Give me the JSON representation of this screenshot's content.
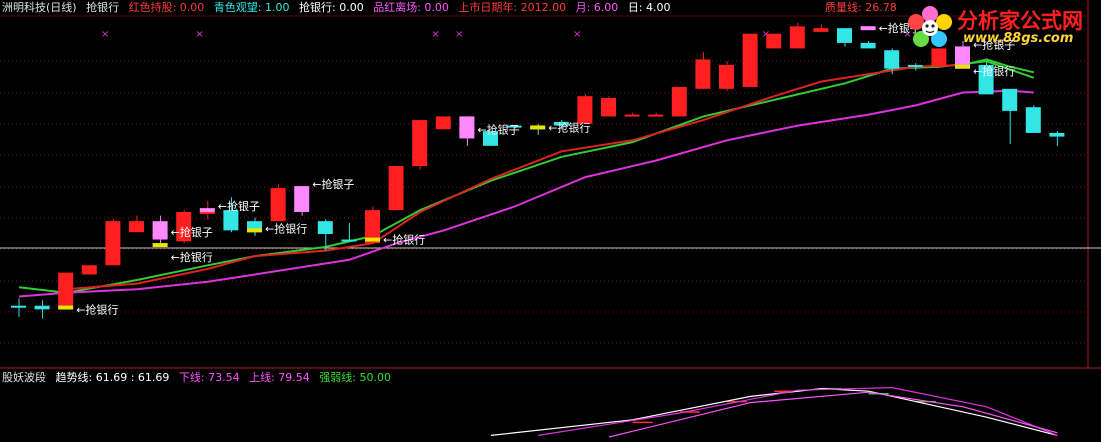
{
  "header": {
    "stock": {
      "text": "洲明科技(日线)",
      "color": "#e0e0e0"
    },
    "indicator": {
      "text": "抢银行",
      "color": "#e0e0e0"
    },
    "items": [
      {
        "label": "红色持股: 0.00",
        "color": "#ff3b3b"
      },
      {
        "label": "青色观望: 1.00",
        "color": "#33e6e6"
      },
      {
        "label": "抢银行: 0.00",
        "color": "#ffffff"
      },
      {
        "label": "品红离场: 0.00",
        "color": "#ff55ff"
      },
      {
        "label": "上市日期年: 2012.00",
        "color": "#ff3b3b"
      },
      {
        "label": "月: 6.00",
        "color": "#ff55ff"
      },
      {
        "label": "日: 4.00",
        "color": "#ffffff"
      }
    ],
    "support_label": "质量线: 26.78",
    "support_color": "#ff3b3b"
  },
  "logo": {
    "brand": "分析家公式网",
    "url": "www.88gs.com"
  },
  "sub_header": {
    "name": {
      "text": "股妖波段",
      "color": "#e0e0e0"
    },
    "items": [
      {
        "label": "趋势线: 61.69 : 61.69",
        "color": "#ffffff"
      },
      {
        "label": "下线: 73.54",
        "color": "#ff55ff"
      },
      {
        "label": "上线: 79.54",
        "color": "#ff55ff"
      },
      {
        "label": "强弱线: 50.00",
        "color": "#33dd33"
      }
    ]
  },
  "colors": {
    "up": "#ff1f1f",
    "down": "#33e6e6",
    "pink": "#ff88ff",
    "yellow": "#e6e600",
    "ma_red": "#dd2222",
    "ma_magenta": "#dd33dd",
    "ma_green": "#33cc33",
    "grid": "#7a1010",
    "label": "#ffffff"
  },
  "chart_data": {
    "type": "candlestick",
    "y_range": [
      12.0,
      30.5
    ],
    "candles": [
      {
        "o": 14.9,
        "c": 14.9,
        "h": 15.3,
        "l": 14.3,
        "color": "down"
      },
      {
        "o": 14.9,
        "c": 14.7,
        "h": 15.2,
        "l": 14.2,
        "color": "down"
      },
      {
        "o": 14.9,
        "c": 16.7,
        "h": 16.7,
        "l": 14.9,
        "color": "up"
      },
      {
        "o": 16.6,
        "c": 17.1,
        "h": 17.1,
        "l": 16.6,
        "color": "up"
      },
      {
        "o": 17.1,
        "c": 19.5,
        "h": 19.6,
        "l": 17.1,
        "color": "up"
      },
      {
        "o": 18.9,
        "c": 19.5,
        "h": 19.8,
        "l": 18.9,
        "color": "up"
      },
      {
        "o": 19.5,
        "c": 18.5,
        "h": 19.8,
        "l": 18.3,
        "color": "pink"
      },
      {
        "o": 18.4,
        "c": 20.0,
        "h": 20.1,
        "l": 18.3,
        "color": "up"
      },
      {
        "o": 20.0,
        "c": 20.0,
        "h": 20.6,
        "l": 19.6,
        "color": "up"
      },
      {
        "o": 20.1,
        "c": 19.0,
        "h": 20.8,
        "l": 18.9,
        "color": "down"
      },
      {
        "o": 19.5,
        "c": 18.9,
        "h": 19.7,
        "l": 18.7,
        "color": "down"
      },
      {
        "o": 19.5,
        "c": 21.3,
        "h": 21.5,
        "l": 19.5,
        "color": "up"
      },
      {
        "o": 21.2,
        "c": 20.0,
        "h": 21.3,
        "l": 19.8,
        "color": "pink"
      },
      {
        "o": 19.5,
        "c": 18.8,
        "h": 19.6,
        "l": 17.9,
        "color": "down"
      },
      {
        "o": 18.5,
        "c": 18.5,
        "h": 19.4,
        "l": 18.4,
        "color": "down"
      },
      {
        "o": 18.3,
        "c": 20.1,
        "h": 20.3,
        "l": 18.3,
        "color": "up"
      },
      {
        "o": 20.1,
        "c": 22.5,
        "h": 22.5,
        "l": 20.1,
        "color": "up"
      },
      {
        "o": 22.5,
        "c": 25.0,
        "h": 25.0,
        "l": 22.3,
        "color": "up"
      },
      {
        "o": 24.5,
        "c": 25.2,
        "h": 25.2,
        "l": 24.5,
        "color": "up"
      },
      {
        "o": 25.2,
        "c": 24.0,
        "h": 25.2,
        "l": 23.6,
        "color": "pink"
      },
      {
        "o": 24.4,
        "c": 23.6,
        "h": 24.4,
        "l": 23.6,
        "color": "down"
      },
      {
        "o": 24.7,
        "c": 24.7,
        "h": 24.7,
        "l": 24.6,
        "color": "down"
      },
      {
        "o": 24.6,
        "c": 24.6,
        "h": 24.8,
        "l": 24.2,
        "color": "down"
      },
      {
        "o": 24.9,
        "c": 24.7,
        "h": 25.0,
        "l": 24.5,
        "color": "down"
      },
      {
        "o": 24.8,
        "c": 26.3,
        "h": 26.4,
        "l": 24.8,
        "color": "up"
      },
      {
        "o": 25.2,
        "c": 26.2,
        "h": 26.3,
        "l": 25.2,
        "color": "up"
      },
      {
        "o": 25.2,
        "c": 25.3,
        "h": 25.4,
        "l": 25.2,
        "color": "up"
      },
      {
        "o": 25.2,
        "c": 25.3,
        "h": 25.4,
        "l": 25.2,
        "color": "up"
      },
      {
        "o": 25.2,
        "c": 26.8,
        "h": 26.8,
        "l": 25.2,
        "color": "up"
      },
      {
        "o": 26.7,
        "c": 28.3,
        "h": 28.7,
        "l": 26.7,
        "color": "up"
      },
      {
        "o": 26.7,
        "c": 28.0,
        "h": 28.2,
        "l": 26.6,
        "color": "up"
      },
      {
        "o": 26.8,
        "c": 29.7,
        "h": 29.7,
        "l": 26.8,
        "color": "up"
      },
      {
        "o": 28.9,
        "c": 29.7,
        "h": 29.7,
        "l": 28.9,
        "color": "up"
      },
      {
        "o": 28.9,
        "c": 30.1,
        "h": 30.3,
        "l": 28.9,
        "color": "up"
      },
      {
        "o": 30.0,
        "c": 29.8,
        "h": 30.2,
        "l": 29.8,
        "color": "up"
      },
      {
        "o": 30.0,
        "c": 29.2,
        "h": 30.0,
        "l": 29.0,
        "color": "down"
      },
      {
        "o": 29.2,
        "c": 28.9,
        "h": 29.3,
        "l": 28.9,
        "color": "down"
      },
      {
        "o": 28.8,
        "c": 27.8,
        "h": 28.9,
        "l": 27.5,
        "color": "down"
      },
      {
        "o": 28.0,
        "c": 27.9,
        "h": 28.1,
        "l": 27.7,
        "color": "down"
      },
      {
        "o": 27.9,
        "c": 28.9,
        "h": 28.9,
        "l": 27.9,
        "color": "up"
      },
      {
        "o": 28.9,
        "c": 28.0,
        "h": 29.3,
        "l": 28.0,
        "color": "pink"
      },
      {
        "o": 28.0,
        "c": 26.4,
        "h": 28.2,
        "l": 26.4,
        "color": "down"
      },
      {
        "o": 26.7,
        "c": 25.5,
        "h": 26.7,
        "l": 23.7,
        "color": "down"
      },
      {
        "o": 25.7,
        "c": 24.3,
        "h": 25.8,
        "l": 24.3,
        "color": "down"
      },
      {
        "o": 24.3,
        "c": 24.1,
        "h": 24.4,
        "l": 23.6,
        "color": "down"
      }
    ],
    "lines": [
      {
        "name": "",
        "color": "ma_green",
        "points": [
          [
            0,
            15.9
          ],
          [
            2,
            15.6
          ],
          [
            5,
            16.3
          ],
          [
            8,
            17.1
          ],
          [
            10,
            17.6
          ],
          [
            13,
            18.1
          ],
          [
            15,
            18.7
          ],
          [
            17,
            20.1
          ],
          [
            20,
            21.7
          ],
          [
            23,
            23.0
          ],
          [
            26,
            23.8
          ],
          [
            29,
            25.2
          ],
          [
            32,
            26.1
          ],
          [
            35,
            27.0
          ],
          [
            37,
            27.8
          ],
          [
            39,
            27.9
          ],
          [
            41,
            28.2
          ],
          [
            43,
            27.3
          ]
        ]
      },
      {
        "name": "",
        "color": "ma_red",
        "points": [
          [
            2,
            15.8
          ],
          [
            5,
            16.1
          ],
          [
            8,
            16.9
          ],
          [
            10,
            17.6
          ],
          [
            13,
            17.9
          ],
          [
            15,
            18.3
          ],
          [
            17,
            20.0
          ],
          [
            20,
            21.8
          ],
          [
            23,
            23.3
          ],
          [
            26,
            23.9
          ],
          [
            29,
            25.0
          ],
          [
            32,
            26.3
          ],
          [
            34,
            27.1
          ],
          [
            36,
            27.5
          ],
          [
            38,
            27.9
          ],
          [
            40,
            28.0
          ]
        ]
      },
      {
        "name": "",
        "color": "ma_magenta",
        "points": [
          [
            0,
            15.4
          ],
          [
            2,
            15.6
          ],
          [
            5,
            15.8
          ],
          [
            8,
            16.2
          ],
          [
            11,
            16.8
          ],
          [
            14,
            17.4
          ],
          [
            16,
            18.3
          ],
          [
            18,
            19.0
          ],
          [
            21,
            20.3
          ],
          [
            24,
            21.9
          ],
          [
            27,
            22.8
          ],
          [
            30,
            23.9
          ],
          [
            33,
            24.7
          ],
          [
            36,
            25.3
          ],
          [
            38,
            25.8
          ],
          [
            40,
            26.5
          ],
          [
            42,
            26.6
          ],
          [
            43,
            26.5
          ]
        ]
      },
      {
        "name": "",
        "color": "ma_green",
        "points": [
          [
            40,
            28.0
          ],
          [
            41,
            28.3
          ],
          [
            42,
            27.9
          ],
          [
            43,
            27.6
          ]
        ]
      }
    ],
    "markers": [
      {
        "i": 2,
        "y": 14.8,
        "color": "yellow",
        "text": "抢银行",
        "dy": 2
      },
      {
        "i": 6,
        "y": 18.7,
        "color": "pink",
        "text": "抢银子",
        "dy": -4
      },
      {
        "i": 6,
        "y": 18.2,
        "color": "yellow",
        "text": "抢银行",
        "dy": 12
      },
      {
        "i": 8,
        "y": 20.1,
        "color": "pink",
        "text": "抢银子",
        "dy": -4
      },
      {
        "i": 10,
        "y": 19.0,
        "color": "yellow",
        "text": "抢银行",
        "dy": -2
      },
      {
        "i": 12,
        "y": 21.3,
        "color": "pink",
        "text": "抢银子",
        "dy": -4
      },
      {
        "i": 15,
        "y": 18.5,
        "color": "yellow",
        "text": "抢银行",
        "dy": 0
      },
      {
        "i": 19,
        "y": 24.5,
        "color": "pink",
        "text": "抢银子",
        "dy": 0
      },
      {
        "i": 22,
        "y": 24.6,
        "color": "yellow",
        "text": "抢银行",
        "dy": 0
      },
      {
        "i": 36,
        "y": 30.0,
        "color": "pink",
        "text": "抢银子",
        "dy": 0
      },
      {
        "i": 40,
        "y": 28.9,
        "color": "pink",
        "text": "抢银子",
        "dy": -4
      },
      {
        "i": 40,
        "y": 27.9,
        "color": "yellow",
        "text": "抢银行",
        "dy": 4
      }
    ],
    "top_dots": [
      2,
      6,
      16,
      17,
      22,
      30,
      36
    ],
    "sub_panel": {
      "y_range": [
        0,
        100
      ],
      "lines": [
        {
          "name": "",
          "color": "#ffffff",
          "points": [
            [
              20,
              5
            ],
            [
              26,
              35
            ],
            [
              31,
              80
            ],
            [
              34,
              95
            ],
            [
              36,
              90
            ],
            [
              38,
              70
            ],
            [
              41,
              40
            ],
            [
              44,
              5
            ]
          ]
        },
        {
          "name": "",
          "color": "#dd33dd",
          "points": [
            [
              22,
              5
            ],
            [
              28,
              48
            ],
            [
              33,
              92
            ],
            [
              37,
              97
            ],
            [
              41,
              60
            ],
            [
              44,
              5
            ]
          ]
        },
        {
          "name": "",
          "color": "#ff55ff",
          "points": [
            [
              25,
              2
            ],
            [
              31,
              68
            ],
            [
              36,
              88
            ],
            [
              40,
              60
            ],
            [
              44,
              10
            ]
          ]
        }
      ],
      "bars": [
        {
          "i": 26,
          "v": 30,
          "color": "#ff3030"
        },
        {
          "i": 28,
          "v": 50,
          "color": "#ff3030"
        },
        {
          "i": 30,
          "v": 70,
          "color": "#ff3030"
        },
        {
          "i": 32,
          "v": 90,
          "color": "#ff3030"
        },
        {
          "i": 34,
          "v": 95,
          "color": "#33cc33"
        },
        {
          "i": 36,
          "v": 85,
          "color": "#33cc33"
        },
        {
          "i": 38,
          "v": 70,
          "color": "#33cc33"
        }
      ]
    }
  }
}
